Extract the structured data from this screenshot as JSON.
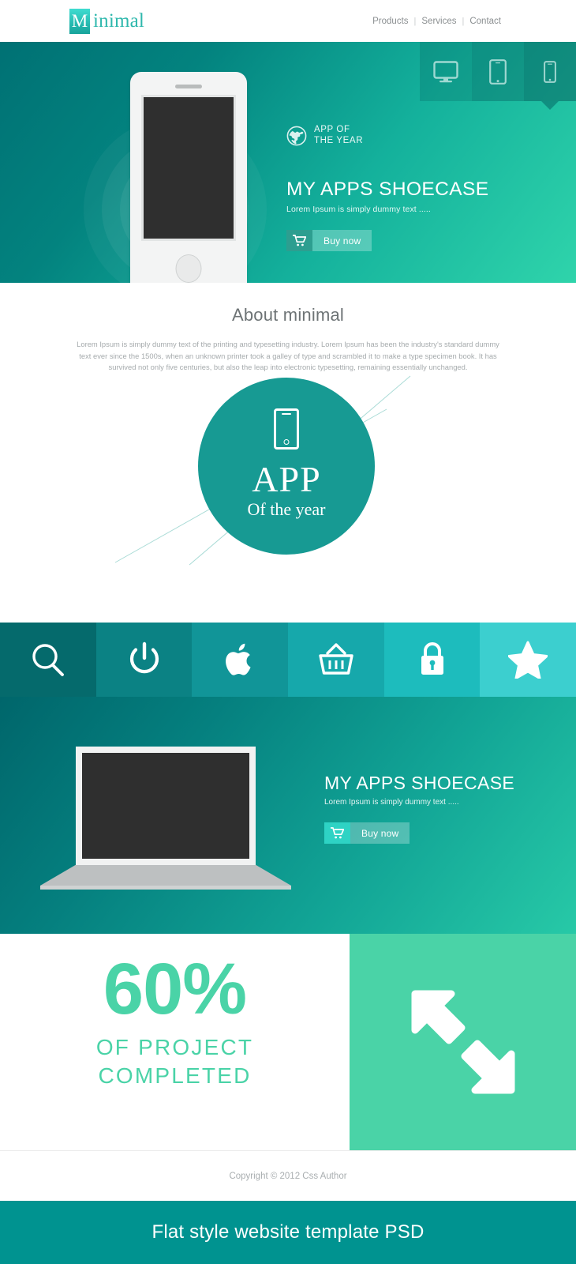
{
  "header": {
    "logo_mark": "M",
    "logo_text": "inimal",
    "nav": [
      {
        "label": "Products"
      },
      {
        "label": "Services"
      },
      {
        "label": "Contact"
      }
    ],
    "nav_separator": "|"
  },
  "hero": {
    "device_tabs": [
      {
        "icon": "desktop-icon",
        "active": false
      },
      {
        "icon": "tablet-icon",
        "active": false
      },
      {
        "icon": "phone-icon",
        "active": true
      }
    ],
    "award_line1": "APP OF",
    "award_line2": "THE YEAR",
    "title": "MY APPS SHOECASE",
    "subtitle": "Lorem Ipsum is simply dummy text .....",
    "buy_label": "Buy now"
  },
  "about": {
    "title": "About minimal",
    "body": "Lorem Ipsum is simply dummy text of the printing and typesetting industry. Lorem Ipsum has been the industry's standard dummy text ever since the 1500s, when an unknown printer took a galley of type and scrambled it to make a type specimen book. It has survived not only five centuries, but also the leap into electronic typesetting, remaining essentially unchanged.",
    "badge_title": "APP",
    "badge_subtitle": "Of the year"
  },
  "icon_strip": [
    {
      "icon": "search-icon",
      "color": "#056a6c"
    },
    {
      "icon": "power-icon",
      "color": "#0b8284"
    },
    {
      "icon": "apple-icon",
      "color": "#119598"
    },
    {
      "icon": "basket-icon",
      "color": "#16a8ab"
    },
    {
      "icon": "lock-icon",
      "color": "#1dbcbd"
    },
    {
      "icon": "star-icon",
      "color": "#3ccfcf"
    }
  ],
  "laptop_section": {
    "title": "MY APPS SHOECASE",
    "subtitle": "Lorem Ipsum is simply dummy text .....",
    "buy_label": "Buy now"
  },
  "stats": {
    "number": "60%",
    "line1": "OF PROJECT",
    "line2": "COMPLETED",
    "panel_icon": "resize-arrows-icon",
    "panel_color": "#4ad3a7"
  },
  "footer": {
    "copyright": "Copyright © 2012 Css Author",
    "ribbon": "Flat style  website template PSD"
  },
  "colors": {
    "brand_teal": "#179a93",
    "accent_green": "#4ad3a7",
    "ribbon_teal": "#009390"
  }
}
